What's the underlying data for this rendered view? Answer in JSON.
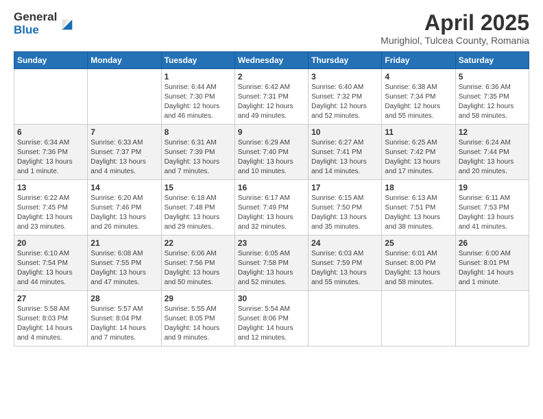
{
  "logo": {
    "general": "General",
    "blue": "Blue"
  },
  "title": "April 2025",
  "subtitle": "Murighiol, Tulcea County, Romania",
  "days_header": [
    "Sunday",
    "Monday",
    "Tuesday",
    "Wednesday",
    "Thursday",
    "Friday",
    "Saturday"
  ],
  "weeks": [
    [
      {
        "num": "",
        "info": ""
      },
      {
        "num": "",
        "info": ""
      },
      {
        "num": "1",
        "info": "Sunrise: 6:44 AM\nSunset: 7:30 PM\nDaylight: 12 hours and 46 minutes."
      },
      {
        "num": "2",
        "info": "Sunrise: 6:42 AM\nSunset: 7:31 PM\nDaylight: 12 hours and 49 minutes."
      },
      {
        "num": "3",
        "info": "Sunrise: 6:40 AM\nSunset: 7:32 PM\nDaylight: 12 hours and 52 minutes."
      },
      {
        "num": "4",
        "info": "Sunrise: 6:38 AM\nSunset: 7:34 PM\nDaylight: 12 hours and 55 minutes."
      },
      {
        "num": "5",
        "info": "Sunrise: 6:36 AM\nSunset: 7:35 PM\nDaylight: 12 hours and 58 minutes."
      }
    ],
    [
      {
        "num": "6",
        "info": "Sunrise: 6:34 AM\nSunset: 7:36 PM\nDaylight: 13 hours and 1 minute."
      },
      {
        "num": "7",
        "info": "Sunrise: 6:33 AM\nSunset: 7:37 PM\nDaylight: 13 hours and 4 minutes."
      },
      {
        "num": "8",
        "info": "Sunrise: 6:31 AM\nSunset: 7:39 PM\nDaylight: 13 hours and 7 minutes."
      },
      {
        "num": "9",
        "info": "Sunrise: 6:29 AM\nSunset: 7:40 PM\nDaylight: 13 hours and 10 minutes."
      },
      {
        "num": "10",
        "info": "Sunrise: 6:27 AM\nSunset: 7:41 PM\nDaylight: 13 hours and 14 minutes."
      },
      {
        "num": "11",
        "info": "Sunrise: 6:25 AM\nSunset: 7:42 PM\nDaylight: 13 hours and 17 minutes."
      },
      {
        "num": "12",
        "info": "Sunrise: 6:24 AM\nSunset: 7:44 PM\nDaylight: 13 hours and 20 minutes."
      }
    ],
    [
      {
        "num": "13",
        "info": "Sunrise: 6:22 AM\nSunset: 7:45 PM\nDaylight: 13 hours and 23 minutes."
      },
      {
        "num": "14",
        "info": "Sunrise: 6:20 AM\nSunset: 7:46 PM\nDaylight: 13 hours and 26 minutes."
      },
      {
        "num": "15",
        "info": "Sunrise: 6:18 AM\nSunset: 7:48 PM\nDaylight: 13 hours and 29 minutes."
      },
      {
        "num": "16",
        "info": "Sunrise: 6:17 AM\nSunset: 7:49 PM\nDaylight: 13 hours and 32 minutes."
      },
      {
        "num": "17",
        "info": "Sunrise: 6:15 AM\nSunset: 7:50 PM\nDaylight: 13 hours and 35 minutes."
      },
      {
        "num": "18",
        "info": "Sunrise: 6:13 AM\nSunset: 7:51 PM\nDaylight: 13 hours and 38 minutes."
      },
      {
        "num": "19",
        "info": "Sunrise: 6:11 AM\nSunset: 7:53 PM\nDaylight: 13 hours and 41 minutes."
      }
    ],
    [
      {
        "num": "20",
        "info": "Sunrise: 6:10 AM\nSunset: 7:54 PM\nDaylight: 13 hours and 44 minutes."
      },
      {
        "num": "21",
        "info": "Sunrise: 6:08 AM\nSunset: 7:55 PM\nDaylight: 13 hours and 47 minutes."
      },
      {
        "num": "22",
        "info": "Sunrise: 6:06 AM\nSunset: 7:56 PM\nDaylight: 13 hours and 50 minutes."
      },
      {
        "num": "23",
        "info": "Sunrise: 6:05 AM\nSunset: 7:58 PM\nDaylight: 13 hours and 52 minutes."
      },
      {
        "num": "24",
        "info": "Sunrise: 6:03 AM\nSunset: 7:59 PM\nDaylight: 13 hours and 55 minutes."
      },
      {
        "num": "25",
        "info": "Sunrise: 6:01 AM\nSunset: 8:00 PM\nDaylight: 13 hours and 58 minutes."
      },
      {
        "num": "26",
        "info": "Sunrise: 6:00 AM\nSunset: 8:01 PM\nDaylight: 14 hours and 1 minute."
      }
    ],
    [
      {
        "num": "27",
        "info": "Sunrise: 5:58 AM\nSunset: 8:03 PM\nDaylight: 14 hours and 4 minutes."
      },
      {
        "num": "28",
        "info": "Sunrise: 5:57 AM\nSunset: 8:04 PM\nDaylight: 14 hours and 7 minutes."
      },
      {
        "num": "29",
        "info": "Sunrise: 5:55 AM\nSunset: 8:05 PM\nDaylight: 14 hours and 9 minutes."
      },
      {
        "num": "30",
        "info": "Sunrise: 5:54 AM\nSunset: 8:06 PM\nDaylight: 14 hours and 12 minutes."
      },
      {
        "num": "",
        "info": ""
      },
      {
        "num": "",
        "info": ""
      },
      {
        "num": "",
        "info": ""
      }
    ]
  ]
}
